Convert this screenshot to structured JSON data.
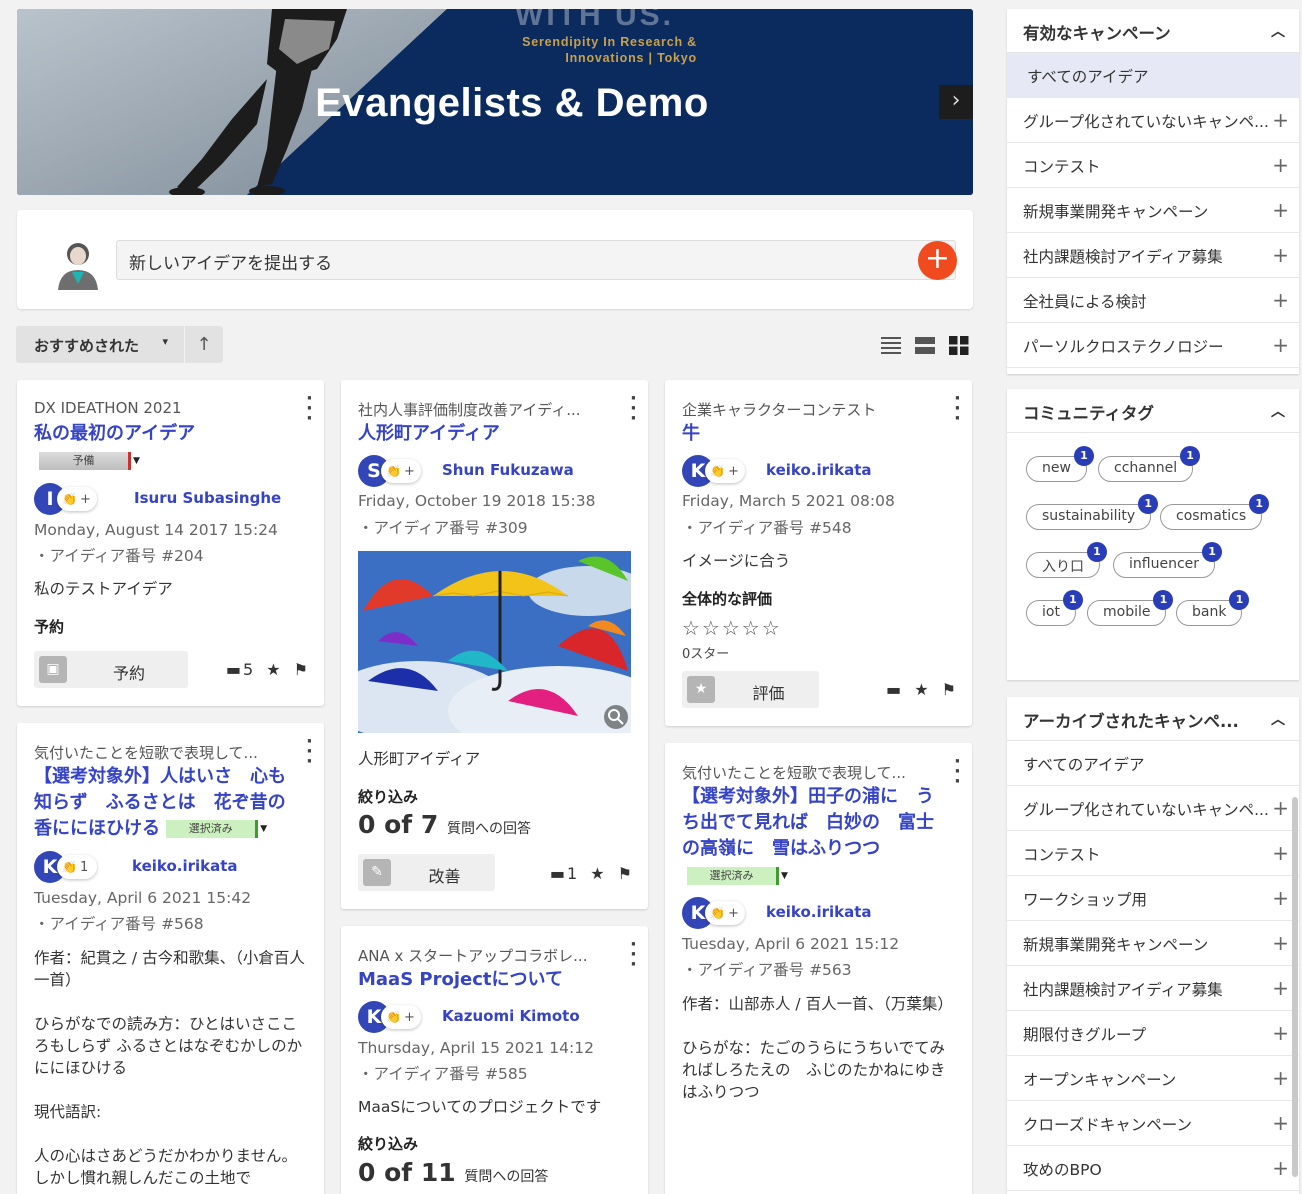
{
  "banner": {
    "title": "Evangelists & Demo",
    "top_text": "WITH US.",
    "subtitle_line1": "Serendipity In Research &",
    "subtitle_line2": "Innovations | Tokyo",
    "next": "›"
  },
  "submit": {
    "placeholder": "新しいアイデアを提出する",
    "add_icon": "+"
  },
  "sort": {
    "label": "おすすめされた",
    "caret": "▾",
    "direction": "↑"
  },
  "cards": [
    {
      "campaign": "DX IDEATHON 2021",
      "title": "私の最初のアイデア",
      "tag": "予備",
      "author_initial": "I",
      "author": "Isuru Subasinghe",
      "react_plus": "+",
      "date": "Monday, August 14 2017 15:24",
      "idea_no": "・アイディア番号 #204",
      "body": "私のテストアイデア",
      "label": "予約",
      "action": "予約",
      "comments": "5"
    },
    {
      "campaign": "社内人事評価制度改善アイディ...",
      "title": "人形町アイディア",
      "author_initial": "S",
      "author": "Shun Fukuzawa",
      "react_plus": "+",
      "date": "Friday, October 19 2018 15:38",
      "idea_no": "・アイディア番号 #309",
      "body": "人形町アイディア",
      "label": "絞り込み",
      "count": "0 of 7",
      "count_label": "質問への回答",
      "action": "改善",
      "comments": "1"
    },
    {
      "campaign": "企業キャラクターコンテスト",
      "title": "牛",
      "author_initial": "K",
      "author": "keiko.irikata",
      "react_plus": "+",
      "date": "Friday, March 5 2021 08:08",
      "idea_no": "・アイディア番号 #548",
      "body": "イメージに合う",
      "label": "全体的な評価",
      "stars": "☆☆☆☆☆",
      "stars_text": "0スター",
      "action": "評価"
    },
    {
      "campaign": "気付いたことを短歌で表現して...",
      "title_line1": "【選考対象外】人はいさ　心も",
      "title_line2": "知らず　ふるさとは　花ぞ昔の",
      "title_line3": "香ににほひける",
      "tag": "選択済み",
      "author_initial": "K",
      "author": "keiko.irikata",
      "react_count": "1",
      "date": "Tuesday, April 6 2021 15:42",
      "idea_no": "・アイディア番号 #568",
      "body1": "作者：紀貫之 / 古今和歌集、（小倉百人一首）",
      "body2": "ひらがなでの読み方：ひとはいさこころもしらず ふるさとはなぞむかしのかににほひける",
      "body3": "現代語訳:",
      "body4": "人の心はさあどうだかわかりません。しかし慣れ親しんだこの土地で"
    },
    {
      "campaign": "ANA x スタートアップコラボレ...",
      "title": "MaaS Projectについて",
      "author_initial": "K",
      "author": "Kazuomi Kimoto",
      "react_plus": "+",
      "date": "Thursday, April 15 2021 14:12",
      "idea_no": "・アイディア番号 #585",
      "body": "MaaSについてのプロジェクトです",
      "label": "絞り込み",
      "count": "0 of 11",
      "count_label": "質問への回答"
    },
    {
      "campaign": "気付いたことを短歌で表現して...",
      "title_line1": "【選考対象外】田子の浦に　う",
      "title_line2": "ち出でて見れば　白妙の　富士",
      "title_line3": "の高嶺に　雪はふりつつ",
      "tag": "選択済み",
      "author_initial": "K",
      "author": "keiko.irikata",
      "react_plus": "+",
      "date": "Tuesday, April 6 2021 15:12",
      "idea_no": "・アイディア番号 #563",
      "body1": "作者：山部赤人 / 百人一首、（万葉集）",
      "body2": "ひらがな：たごのうらにうちいでてみればしろたえの　ふじのたかねにゆきはふりつつ"
    }
  ],
  "panel_active": {
    "title": "有効なキャンペーン",
    "items": [
      "すべてのアイデア",
      "グループ化されていないキャンペ...",
      "コンテスト",
      "新規事業開発キャンペーン",
      "社内課題検討アイディア募集",
      "全社員による検討",
      "パーソルクロステクノロジー"
    ]
  },
  "panel_tags": {
    "title": "コミュニティタグ",
    "tags": [
      {
        "label": "new",
        "count": "1"
      },
      {
        "label": "cchannel",
        "count": "1"
      },
      {
        "label": "sustainability",
        "count": "1"
      },
      {
        "label": "cosmatics",
        "count": "1"
      },
      {
        "label": "入り口",
        "count": "1"
      },
      {
        "label": "influencer",
        "count": "1"
      },
      {
        "label": "iot",
        "count": "1"
      },
      {
        "label": "mobile",
        "count": "1"
      },
      {
        "label": "bank",
        "count": "1"
      }
    ]
  },
  "panel_archived": {
    "title": "アーカイブされたキャンペ...",
    "items": [
      "すべてのアイデア",
      "グループ化されていないキャンペ...",
      "コンテスト",
      "ワークショップ用",
      "新規事業開発キャンペーン",
      "社内課題検討アイディア募集",
      "期限付きグループ",
      "オープンキャンペーン",
      "クローズドキャンペーン",
      "攻めのBPO"
    ]
  },
  "colors": {
    "accent": "#3543c7",
    "add_button": "#f04a1f",
    "badge": "#2a3db8",
    "banner_bg": "#0b2a5e"
  }
}
